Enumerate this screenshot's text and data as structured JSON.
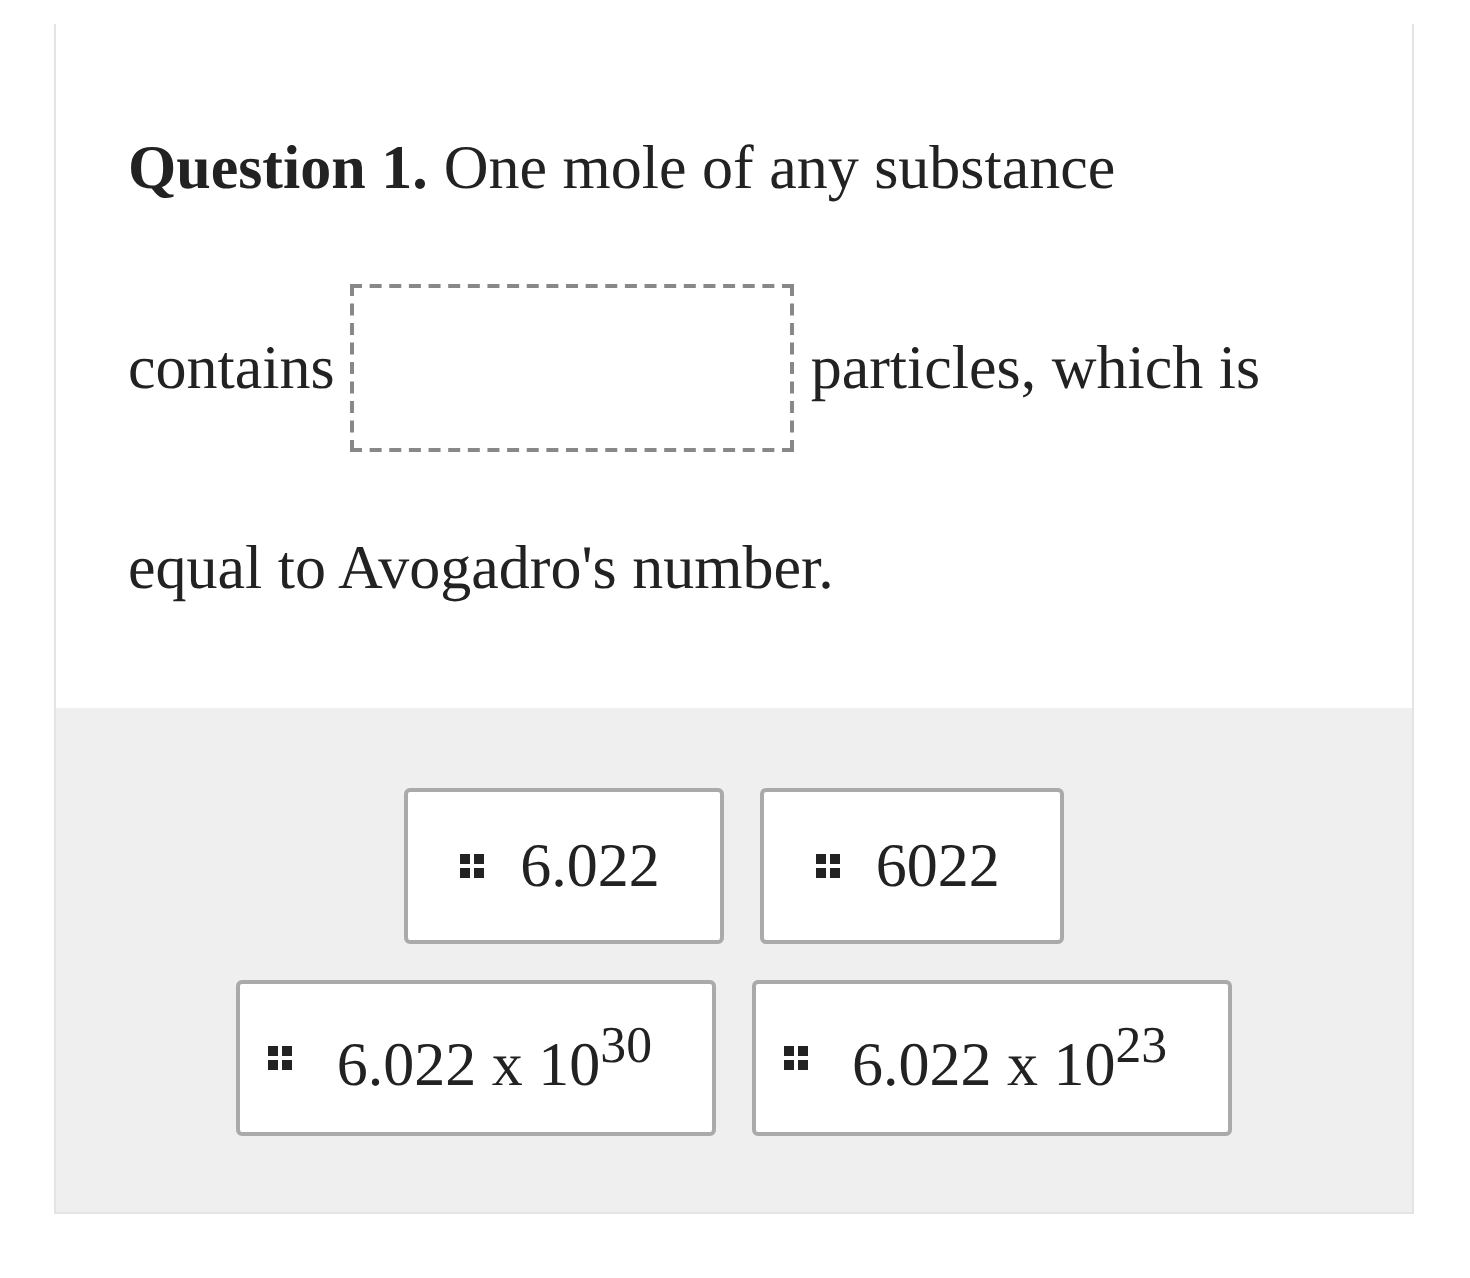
{
  "question": {
    "number": "Question 1.",
    "line_1": "One mole of any substance",
    "before": "contains",
    "after": "particles, which is",
    "line_3": "equal to Avogadro's number."
  },
  "blank": {
    "kind": "drop-zone"
  },
  "options": [
    {
      "label": "6.022"
    },
    {
      "label": "6022"
    },
    {
      "label": "6.022 x 10$^{30}$"
    },
    {
      "label": "6.022 x 10$^{23}$"
    }
  ]
}
